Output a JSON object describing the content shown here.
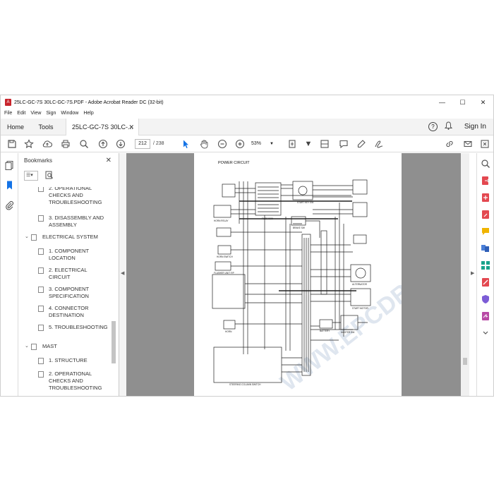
{
  "window": {
    "title": "25LC-GC-7S 30LC-GC-7S.PDF - Adobe Acrobat Reader DC (32-bit)",
    "controls": [
      "—",
      "☐",
      "✕"
    ]
  },
  "menu": [
    "File",
    "Edit",
    "View",
    "Sign",
    "Window",
    "Help"
  ],
  "tabs": {
    "home": "Home",
    "tools": "Tools",
    "document": "25LC-GC-7S 30LC-...",
    "close": "✕"
  },
  "header_right": {
    "help": "?",
    "sign_in": "Sign In"
  },
  "toolbar": {
    "current_page": "212",
    "total_pages": "/ 238",
    "zoom": "53%"
  },
  "bookmarks": {
    "title": "Bookmarks",
    "close": "✕",
    "items": [
      {
        "label": "2. OPERATIONAL CHECKS AND TROUBLESHOOTING",
        "level": 2
      },
      {
        "label": "3. DISASSEMBLY AND ASSEMBLY",
        "level": 2
      },
      {
        "label": "ELECTRICAL SYSTEM",
        "level": 1
      },
      {
        "label": "1. COMPONENT LOCATION",
        "level": 2
      },
      {
        "label": "2. ELECTRICAL CIRCUIT",
        "level": 2
      },
      {
        "label": "3. COMPONENT SPECIFICATION",
        "level": 2
      },
      {
        "label": "4. CONNECTOR DESTINATION",
        "level": 2
      },
      {
        "label": "5. TROUBLESHOOTING",
        "level": 2
      },
      {
        "label": "MAST",
        "level": 1
      },
      {
        "label": "1. STRUCTURE",
        "level": 2
      },
      {
        "label": "2. OPERATIONAL CHECKS AND TROUBLESHOOTING",
        "level": 2
      }
    ]
  },
  "diagram": {
    "title": "POWER CIRCUIT",
    "labels": {
      "fuse_box": "FUSE BOX",
      "start_key_sw": "START KEY SW",
      "brake_sw": "BRAKE SW",
      "horn_relay": "HORN RELAY",
      "horn_switch": "HORN SWITCH",
      "flasher_unit": "FLASHER UNIT F/P",
      "alternator": "ALTERNATOR",
      "start_motor": "START MOTOR",
      "battery": "BATTERY",
      "master_sw": "MASTER SW",
      "horn": "HORN",
      "steering_column_switch": "STEERING COLUMN SWITCH",
      "watermark": "WWW.EPCDB.COM"
    }
  },
  "colors": {
    "acrobat_red": "#c8252c",
    "toolbar_blue": "#1473e6",
    "doc_background": "#8f8f8f"
  }
}
